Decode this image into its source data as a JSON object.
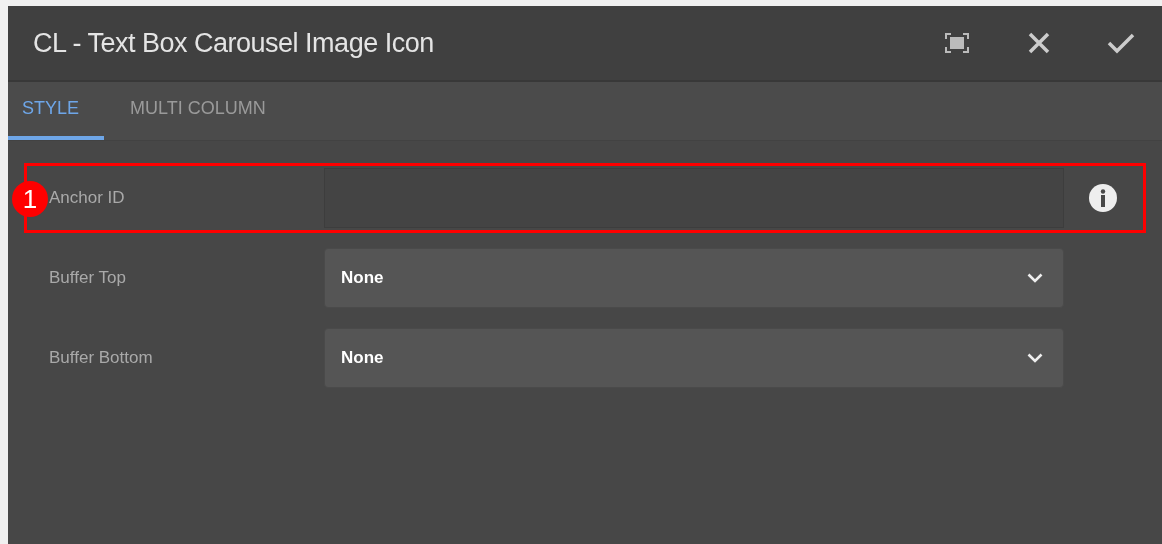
{
  "dialog": {
    "title": "CL - Text Box Carousel Image Icon"
  },
  "tabs": [
    {
      "label": "STYLE",
      "selected": true
    },
    {
      "label": "MULTI COLUMN",
      "selected": false
    }
  ],
  "fields": [
    {
      "kind": "text",
      "label": "Anchor ID",
      "info": true,
      "highlighted": true,
      "callout": "1"
    },
    {
      "kind": "select",
      "label": "Buffer Top",
      "value": "None"
    },
    {
      "kind": "select",
      "label": "Buffer Bottom",
      "value": "None"
    }
  ]
}
